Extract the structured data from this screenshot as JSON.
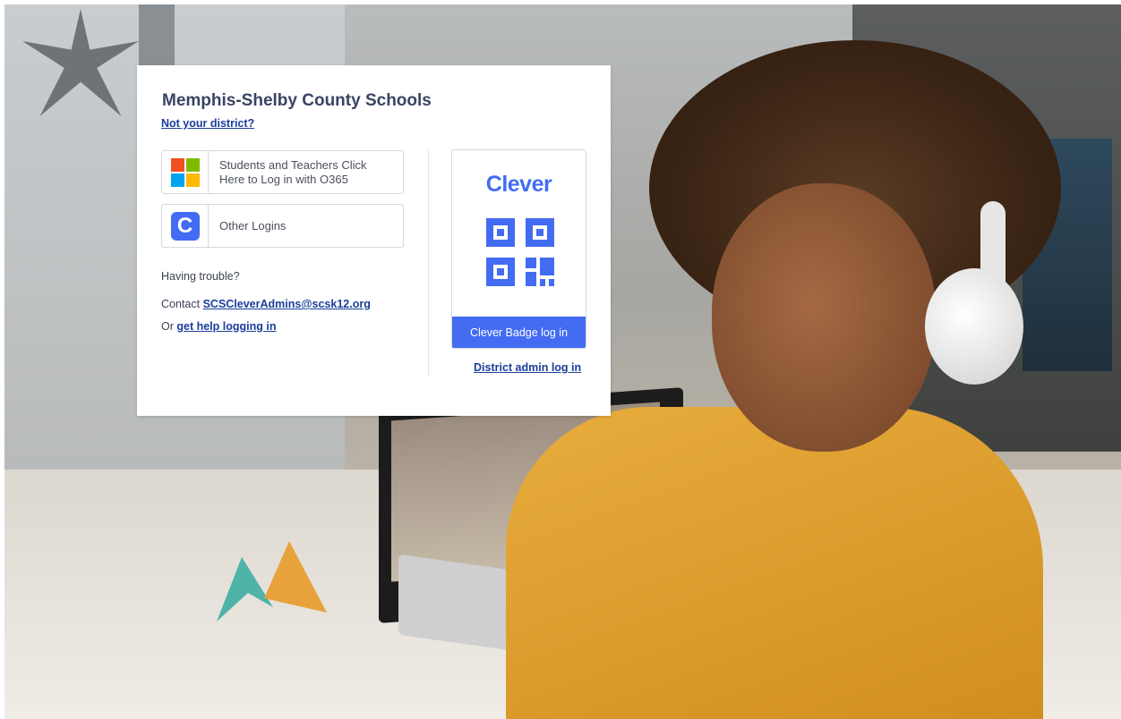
{
  "card": {
    "district_name": "Memphis-Shelby County Schools",
    "not_your_district": "Not your district?",
    "o365_button": {
      "label_line1": "Students and Teachers Click",
      "label_line2": "Here to Log in with O365",
      "icon": "microsoft-logo-icon"
    },
    "other_button": {
      "label": "Other Logins",
      "icon": "clever-c-icon",
      "icon_glyph": "C"
    },
    "help": {
      "heading": "Having trouble?",
      "contact_prefix": "Contact",
      "contact_email": "SCSCleverAdmins@scsk12.org",
      "help_prefix": "Or",
      "help_link": "get help logging in"
    },
    "badge": {
      "brand": "Clever",
      "qr_icon": "qr-code-icon",
      "button_label": "Clever Badge log in"
    },
    "admin_link": "District admin log in"
  },
  "colors": {
    "clever_blue": "#436CF2",
    "title": "#394463",
    "link": "#1A3E9A",
    "ms_red": "#F25022",
    "ms_green": "#7FBA00",
    "ms_blue": "#00A4EF",
    "ms_yellow": "#FFB900"
  }
}
